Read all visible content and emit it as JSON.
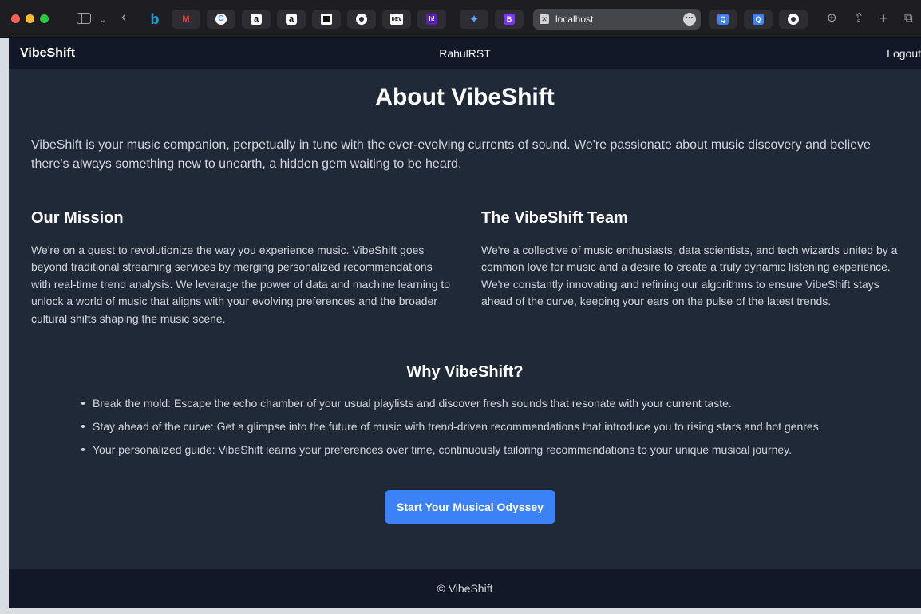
{
  "browser": {
    "url": "localhost",
    "favicons": [
      "bing",
      "gmail",
      "google",
      "amazon",
      "amazon",
      "box",
      "github",
      "dev",
      "hashnode",
      "gemini",
      "bootstrap"
    ],
    "tab_icons_right": [
      "search",
      "search",
      "github"
    ],
    "glyphs": {
      "chevron": "⌄",
      "back": "‹",
      "bing": "b",
      "gmail": "M",
      "google": "G",
      "amazon": "a",
      "dev": "DEV",
      "hashnode": "h!",
      "gemini": "✦",
      "bootstrap": "B",
      "search": "Q",
      "site": "✕",
      "more": "···",
      "download": "⊕",
      "share": "⇪",
      "new_tab": "+",
      "tabs": "⧉"
    }
  },
  "nav": {
    "brand": "VibeShift",
    "username": "RahulRST",
    "logout": "Logout"
  },
  "about": {
    "title": "About VibeShift",
    "intro": "VibeShift is your music companion, perpetually in tune with the ever-evolving currents of sound. We're passionate about music discovery and believe there's always something new to unearth, a hidden gem waiting to be heard."
  },
  "mission": {
    "heading": "Our Mission",
    "body": "We're on a quest to revolutionize the way you experience music. VibeShift goes beyond traditional streaming services by merging personalized recommendations with real-time trend analysis. We leverage the power of data and machine learning to unlock a world of music that aligns with your evolving preferences and the broader cultural shifts shaping the music scene."
  },
  "team": {
    "heading": "The VibeShift Team",
    "body": "We're a collective of music enthusiasts, data scientists, and tech wizards united by a common love for music and a desire to create a truly dynamic listening experience. We're constantly innovating and refining our algorithms to ensure VibeShift stays ahead of the curve, keeping your ears on the pulse of the latest trends."
  },
  "why": {
    "heading": "Why VibeShift?",
    "items": [
      "Break the mold: Escape the echo chamber of your usual playlists and discover fresh sounds that resonate with your current taste.",
      "Stay ahead of the curve: Get a glimpse into the future of music with trend-driven recommendations that introduce you to rising stars and hot genres.",
      "Your personalized guide: VibeShift learns your preferences over time, continuously tailoring recommendations to your unique musical journey."
    ]
  },
  "cta": {
    "label": "Start Your Musical Odyssey"
  },
  "footer": {
    "text": "© VibeShift"
  },
  "colors": {
    "page_bg": "#1f2937",
    "nav_bg": "#111827",
    "accent": "#3b82f6"
  }
}
